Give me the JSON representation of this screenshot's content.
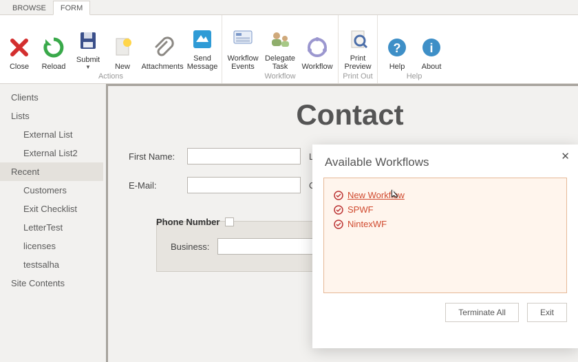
{
  "menu": {
    "browse": "BROWSE",
    "form": "FORM",
    "active": "form"
  },
  "ribbon": {
    "close": "Close",
    "reload": "Reload",
    "submit": "Submit",
    "new": "New",
    "attachments": "Attachments",
    "send_message": "Send Message",
    "workflow_events": "Workflow Events",
    "delegate_task": "Delegate Task",
    "workflow": "Workflow",
    "print_preview": "Print Preview",
    "help": "Help",
    "about": "About",
    "groups": {
      "actions": "Actions",
      "workflow": "Workflow",
      "print": "Print Out",
      "help": "Help"
    }
  },
  "sidebar": {
    "items": [
      {
        "label": "Clients",
        "type": "parent"
      },
      {
        "label": "Lists",
        "type": "parent"
      },
      {
        "label": "External List",
        "type": "child"
      },
      {
        "label": "External List2",
        "type": "child"
      },
      {
        "label": "Recent",
        "type": "parent",
        "selected": true
      },
      {
        "label": "Customers",
        "type": "child"
      },
      {
        "label": "Exit Checklist",
        "type": "child"
      },
      {
        "label": "LetterTest",
        "type": "child"
      },
      {
        "label": "licenses",
        "type": "child"
      },
      {
        "label": "testsalha",
        "type": "child"
      },
      {
        "label": "Site Contents",
        "type": "parent"
      }
    ]
  },
  "form": {
    "title": "Contact",
    "first_name_label": "First Name:",
    "last_prefix": "La",
    "email_label": "E-Mail:",
    "co_prefix": "Co",
    "phone_group_label": "Phone Number",
    "business_label": "Business:"
  },
  "popup": {
    "title": "Available Workflows",
    "items": [
      {
        "label": "New Workflow",
        "highlight": true
      },
      {
        "label": "SPWF"
      },
      {
        "label": "NintexWF"
      }
    ],
    "terminate": "Terminate All",
    "exit": "Exit"
  }
}
